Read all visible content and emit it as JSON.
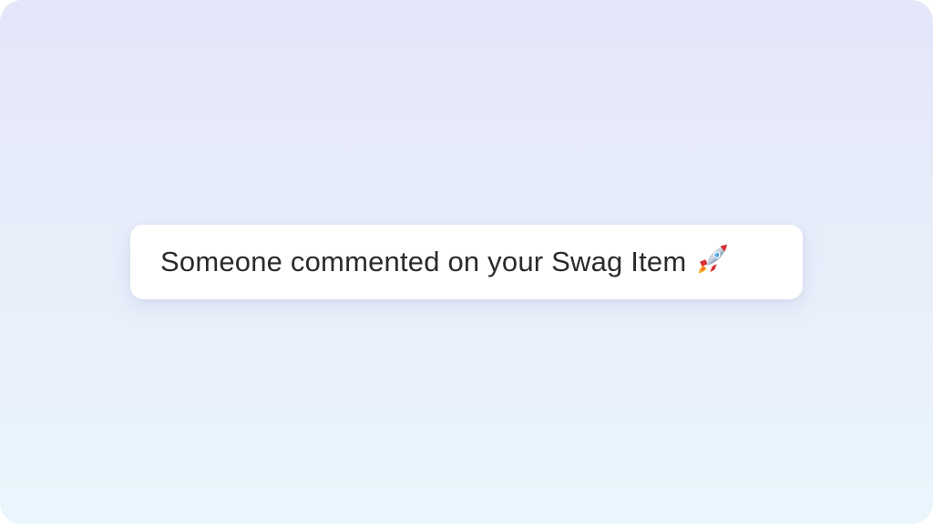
{
  "notification": {
    "message": "Someone commented on your Swag Item",
    "icon": "rocket-icon"
  },
  "colors": {
    "background_top": "#e4e6f9",
    "background_bottom": "#eaf6fd",
    "card": "#ffffff",
    "text": "#2b2b2f"
  }
}
